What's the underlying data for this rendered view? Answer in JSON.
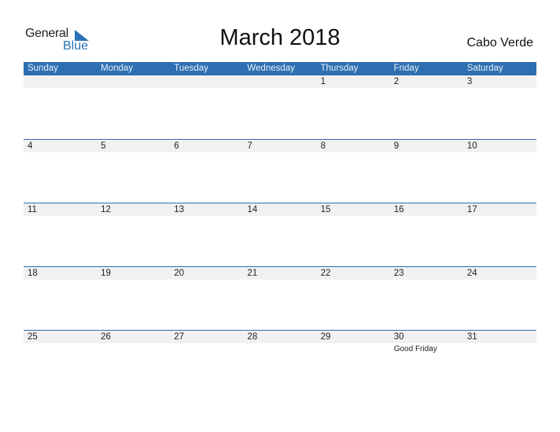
{
  "logo": {
    "word1": "General",
    "word2": "Blue"
  },
  "title": "March 2018",
  "country": "Cabo Verde",
  "colors": {
    "accent": "#2d6fb0",
    "band": "#f1f1f1"
  },
  "weekdays": [
    "Sunday",
    "Monday",
    "Tuesday",
    "Wednesday",
    "Thursday",
    "Friday",
    "Saturday"
  ],
  "weeks": [
    [
      {
        "d": ""
      },
      {
        "d": ""
      },
      {
        "d": ""
      },
      {
        "d": ""
      },
      {
        "d": "1"
      },
      {
        "d": "2"
      },
      {
        "d": "3"
      }
    ],
    [
      {
        "d": "4"
      },
      {
        "d": "5"
      },
      {
        "d": "6"
      },
      {
        "d": "7"
      },
      {
        "d": "8"
      },
      {
        "d": "9"
      },
      {
        "d": "10"
      }
    ],
    [
      {
        "d": "11"
      },
      {
        "d": "12"
      },
      {
        "d": "13"
      },
      {
        "d": "14"
      },
      {
        "d": "15"
      },
      {
        "d": "16"
      },
      {
        "d": "17"
      }
    ],
    [
      {
        "d": "18"
      },
      {
        "d": "19"
      },
      {
        "d": "20"
      },
      {
        "d": "21"
      },
      {
        "d": "22"
      },
      {
        "d": "23"
      },
      {
        "d": "24"
      }
    ],
    [
      {
        "d": "25"
      },
      {
        "d": "26"
      },
      {
        "d": "27"
      },
      {
        "d": "28"
      },
      {
        "d": "29"
      },
      {
        "d": "30",
        "event": "Good Friday"
      },
      {
        "d": "31"
      }
    ]
  ]
}
